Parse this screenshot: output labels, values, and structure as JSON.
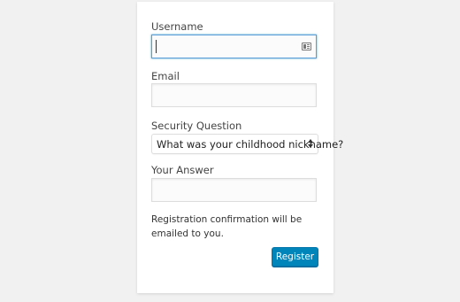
{
  "form": {
    "username_label": "Username",
    "username_value": "",
    "email_label": "Email",
    "email_value": "",
    "security_label": "Security Question",
    "security_selected": "What was your childhood nickname?",
    "answer_label": "Your Answer",
    "answer_value": "",
    "note": "Registration confirmation will be emailed to you.",
    "submit_label": "Register"
  },
  "colors": {
    "background": "#f1f1f1",
    "card": "#ffffff",
    "focus_border": "#5b9dd9",
    "button": "#0085ba"
  },
  "icons": {
    "username_autofill": "contact-card-icon",
    "select_arrows": "select-arrows-icon"
  }
}
